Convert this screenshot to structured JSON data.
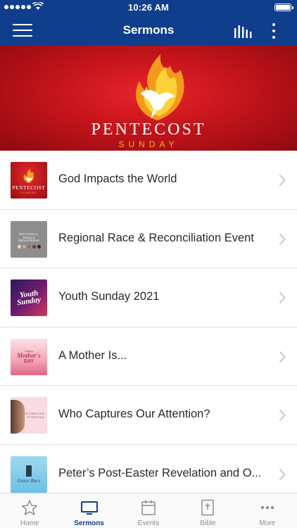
{
  "status_bar": {
    "time": "10:26 AM"
  },
  "nav": {
    "title": "Sermons"
  },
  "banner": {
    "title": "PENTECOST",
    "subtitle": "SUNDAY"
  },
  "sermons": [
    {
      "title": "God Impacts the World",
      "thumb": {
        "line1": "PENTECOST",
        "line2": "SUNDAY"
      }
    },
    {
      "title": "Regional Race & Reconciliation Event",
      "thumb": {
        "line1": "REGIONAL",
        "line2": "RACE &",
        "line3": "Reconciliation"
      }
    },
    {
      "title": "Youth Sunday 2021",
      "thumb": {
        "line1": "Youth",
        "line2": "Sunday"
      }
    },
    {
      "title": "A Mother Is...",
      "thumb": {
        "line1": "Happy",
        "line2": "Mother's",
        "line3": "DAY"
      }
    },
    {
      "title": "Who Captures Our Attention?",
      "thumb": {
        "line1": "WHO CAPTURES OUR",
        "line2": "ATTENTION?"
      }
    },
    {
      "title": "Peter’s Post-Easter Revelation and O...",
      "thumb": {
        "line1": "Grace Race"
      }
    }
  ],
  "tabs": [
    {
      "label": "Home",
      "icon": "star-icon"
    },
    {
      "label": "Sermons",
      "icon": "tv-icon"
    },
    {
      "label": "Events",
      "icon": "calendar-icon"
    },
    {
      "label": "Bible",
      "icon": "bible-icon"
    },
    {
      "label": "More",
      "icon": "more-dots-icon"
    }
  ],
  "colors": {
    "nav_background": "#0f3f8c",
    "banner_red": "#c4141b",
    "accent_gold": "#f6b21f",
    "active_tab": "#0f3f8c",
    "inactive_tab": "#8e8e8e"
  }
}
